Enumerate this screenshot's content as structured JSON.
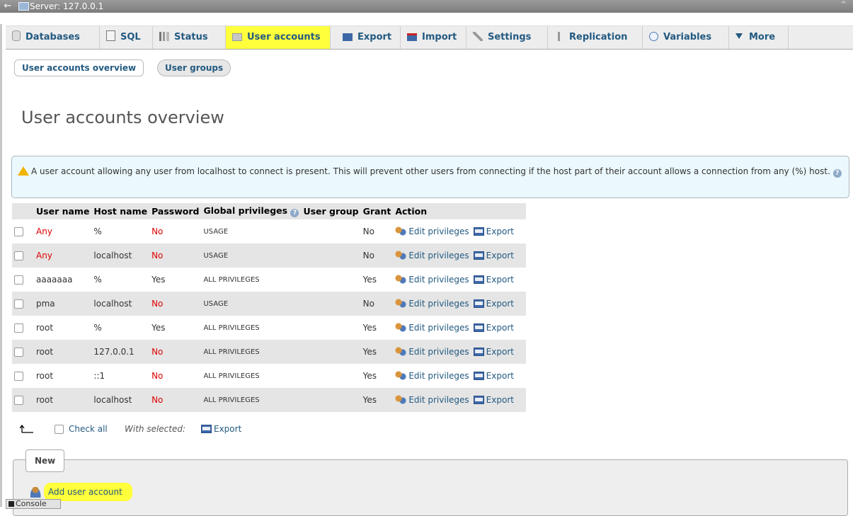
{
  "topbar": {
    "back": "←",
    "server_label": "Server: 127.0.0.1",
    "collapse": "⌃"
  },
  "tabs": [
    {
      "label": "Databases",
      "icon": "database-icon"
    },
    {
      "label": "SQL",
      "icon": "sql-icon"
    },
    {
      "label": "Status",
      "icon": "status-icon"
    },
    {
      "label": "User accounts",
      "icon": "user-accounts-icon",
      "active": true
    },
    {
      "label": "Export",
      "icon": "export-icon"
    },
    {
      "label": "Import",
      "icon": "import-icon"
    },
    {
      "label": "Settings",
      "icon": "wrench-icon"
    },
    {
      "label": "Replication",
      "icon": "replication-icon"
    },
    {
      "label": "Variables",
      "icon": "variables-icon"
    },
    {
      "label": "More",
      "icon": "triangle-down-icon"
    }
  ],
  "subtabs": {
    "overview": "User accounts overview",
    "groups": "User groups"
  },
  "page_title": "User accounts overview",
  "notice": {
    "text": "A user account allowing any user from localhost to connect is present. This will prevent other users from connecting if the host part of their account allows a connection from any (%) host.",
    "help": "?"
  },
  "table": {
    "headers": [
      "User name",
      "Host name",
      "Password",
      "Global privileges",
      "User group",
      "Grant",
      "Action"
    ],
    "edit_label": "Edit privileges",
    "export_label": "Export",
    "rows": [
      {
        "user": "Any",
        "host": "%",
        "password": "No",
        "privileges": "USAGE",
        "group": "",
        "grant": "No"
      },
      {
        "user": "Any",
        "host": "localhost",
        "password": "No",
        "privileges": "USAGE",
        "group": "",
        "grant": "No"
      },
      {
        "user": "aaaaaaa",
        "host": "%",
        "password": "Yes",
        "privileges": "ALL PRIVILEGES",
        "group": "",
        "grant": "Yes"
      },
      {
        "user": "pma",
        "host": "localhost",
        "password": "No",
        "privileges": "USAGE",
        "group": "",
        "grant": "No"
      },
      {
        "user": "root",
        "host": "%",
        "password": "Yes",
        "privileges": "ALL PRIVILEGES",
        "group": "",
        "grant": "Yes"
      },
      {
        "user": "root",
        "host": "127.0.0.1",
        "password": "No",
        "privileges": "ALL PRIVILEGES",
        "group": "",
        "grant": "Yes"
      },
      {
        "user": "root",
        "host": "::1",
        "password": "No",
        "privileges": "ALL PRIVILEGES",
        "group": "",
        "grant": "Yes"
      },
      {
        "user": "root",
        "host": "localhost",
        "password": "No",
        "privileges": "ALL PRIVILEGES",
        "group": "",
        "grant": "Yes"
      }
    ]
  },
  "bulk": {
    "check_all": "Check all",
    "with_selected": "With selected:",
    "export": "Export"
  },
  "new_section": {
    "legend": "New",
    "add_user": "Add user account"
  },
  "console": {
    "label": "Console"
  },
  "colors": {
    "highlight": "#ffff3b",
    "link": "#235a81",
    "error": "#dd0000",
    "notice_bg": "#ebf8fd"
  }
}
